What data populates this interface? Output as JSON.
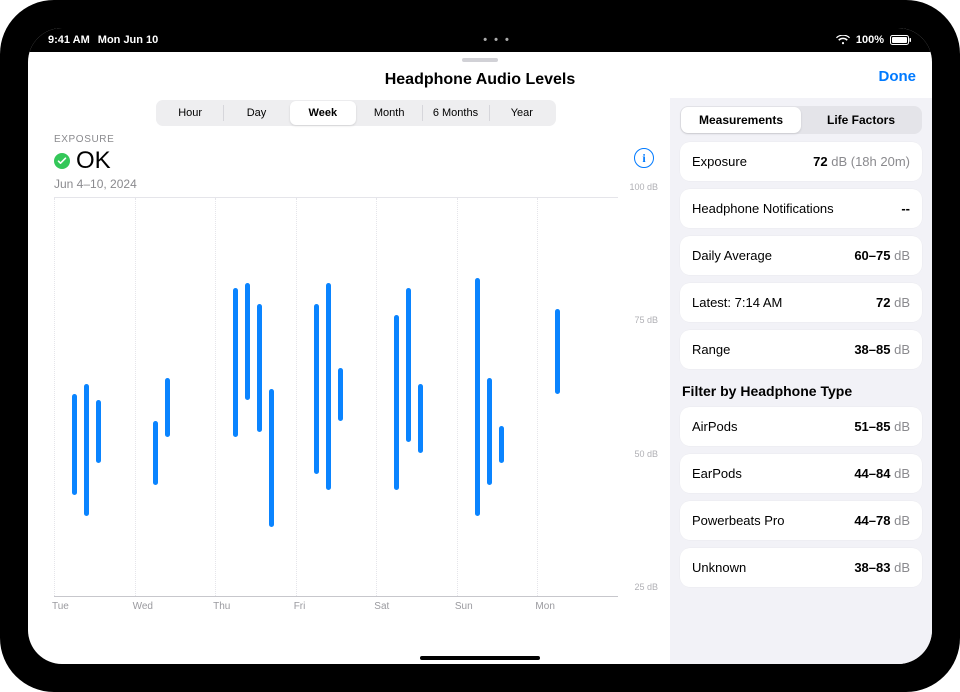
{
  "status_bar": {
    "time": "9:41 AM",
    "date": "Mon Jun 10",
    "battery": "100%"
  },
  "header": {
    "title": "Headphone Audio Levels",
    "done": "Done"
  },
  "time_segments": [
    "Hour",
    "Day",
    "Week",
    "Month",
    "6 Months",
    "Year"
  ],
  "time_selected": 2,
  "exposure": {
    "label": "EXPOSURE",
    "status": "OK",
    "date_range": "Jun 4–10, 2024"
  },
  "side": {
    "tabs": [
      "Measurements",
      "Life Factors"
    ],
    "selected": 0,
    "metrics": [
      {
        "label": "Exposure",
        "value": "72",
        "unit": "dB (18h 20m)"
      },
      {
        "label": "Headphone Notifications",
        "value": "--",
        "unit": ""
      },
      {
        "label": "Daily Average",
        "value": "60–75",
        "unit": "dB"
      },
      {
        "label": "Latest: 7:14 AM",
        "value": "72",
        "unit": "dB"
      },
      {
        "label": "Range",
        "value": "38–85",
        "unit": "dB"
      }
    ],
    "filter_heading": "Filter by Headphone Type",
    "filters": [
      {
        "label": "AirPods",
        "value": "51–85",
        "unit": "dB"
      },
      {
        "label": "EarPods",
        "value": "44–84",
        "unit": "dB"
      },
      {
        "label": "Powerbeats Pro",
        "value": "44–78",
        "unit": "dB"
      },
      {
        "label": "Unknown",
        "value": "38–83",
        "unit": "dB"
      }
    ]
  },
  "chart_data": {
    "type": "range-bar",
    "title": "Headphone Audio Levels",
    "ylabel": "dB",
    "ylim": [
      25,
      100
    ],
    "y_ticks": [
      25,
      50,
      75,
      100
    ],
    "y_tick_labels": [
      "25 dB",
      "50 dB",
      "75 dB",
      "100 dB"
    ],
    "categories": [
      "Tue",
      "Wed",
      "Thu",
      "Fri",
      "Sat",
      "Sun",
      "Mon"
    ],
    "series": [
      {
        "name": "readings",
        "color": "#0a84ff",
        "bars": [
          {
            "day": 0,
            "slot": 0,
            "low": 44,
            "high": 63
          },
          {
            "day": 0,
            "slot": 1,
            "low": 40,
            "high": 65
          },
          {
            "day": 0,
            "slot": 2,
            "low": 50,
            "high": 62
          },
          {
            "day": 1,
            "slot": 0,
            "low": 46,
            "high": 58
          },
          {
            "day": 1,
            "slot": 1,
            "low": 55,
            "high": 66
          },
          {
            "day": 2,
            "slot": 0,
            "low": 55,
            "high": 83
          },
          {
            "day": 2,
            "slot": 1,
            "low": 62,
            "high": 84
          },
          {
            "day": 2,
            "slot": 2,
            "low": 56,
            "high": 80
          },
          {
            "day": 2,
            "slot": 3,
            "low": 38,
            "high": 64
          },
          {
            "day": 3,
            "slot": 0,
            "low": 48,
            "high": 80
          },
          {
            "day": 3,
            "slot": 1,
            "low": 45,
            "high": 84
          },
          {
            "day": 3,
            "slot": 2,
            "low": 58,
            "high": 68
          },
          {
            "day": 4,
            "slot": 0,
            "low": 45,
            "high": 78
          },
          {
            "day": 4,
            "slot": 1,
            "low": 54,
            "high": 83
          },
          {
            "day": 4,
            "slot": 2,
            "low": 52,
            "high": 65
          },
          {
            "day": 5,
            "slot": 0,
            "low": 40,
            "high": 85
          },
          {
            "day": 5,
            "slot": 1,
            "low": 46,
            "high": 66
          },
          {
            "day": 5,
            "slot": 2,
            "low": 50,
            "high": 57
          },
          {
            "day": 6,
            "slot": 0,
            "low": 63,
            "high": 79
          }
        ]
      }
    ]
  }
}
